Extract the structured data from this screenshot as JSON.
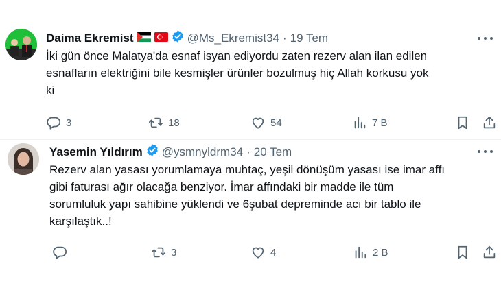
{
  "tweets": [
    {
      "name": "Daima Ekremist",
      "handle": "@Ms_Ekremist34",
      "separator": "·",
      "date": "19 Tem",
      "text_lines": [
        "İki gün önce Malatya'da esnaf isyan ediyordu zaten rezerv alan ilan edilen",
        "esnafların elektriğini bile kesmişler ürünler bozulmuş hiç Allah korkusu yok",
        "ki"
      ],
      "replies": "3",
      "retweets": "18",
      "likes": "54",
      "views": "7 B",
      "flags": [
        "palestine-flag",
        "turkey-flag"
      ]
    },
    {
      "name": "Yasemin Yıldırım",
      "handle": "@ysmnyldrm34",
      "separator": "·",
      "date": "20 Tem",
      "text_lines": [
        "Rezerv alan yasası yorumlamaya muhtaç, yeşil dönüşüm yasası ise imar affı",
        "gibi faturası ağır olacağa benziyor. İmar affındaki bir madde ile tüm",
        "sorumluluk yapı sahibine yüklendi ve 6şubat  depreminde acı bir tablo ile",
        "karşılaştık..!"
      ],
      "replies": "",
      "retweets": "3",
      "likes": "4",
      "views": "2 B"
    }
  ],
  "colors": {
    "text": "#0f1419",
    "muted": "#536471",
    "verified": "#1d9bf0",
    "divider": "#eff3f4"
  }
}
